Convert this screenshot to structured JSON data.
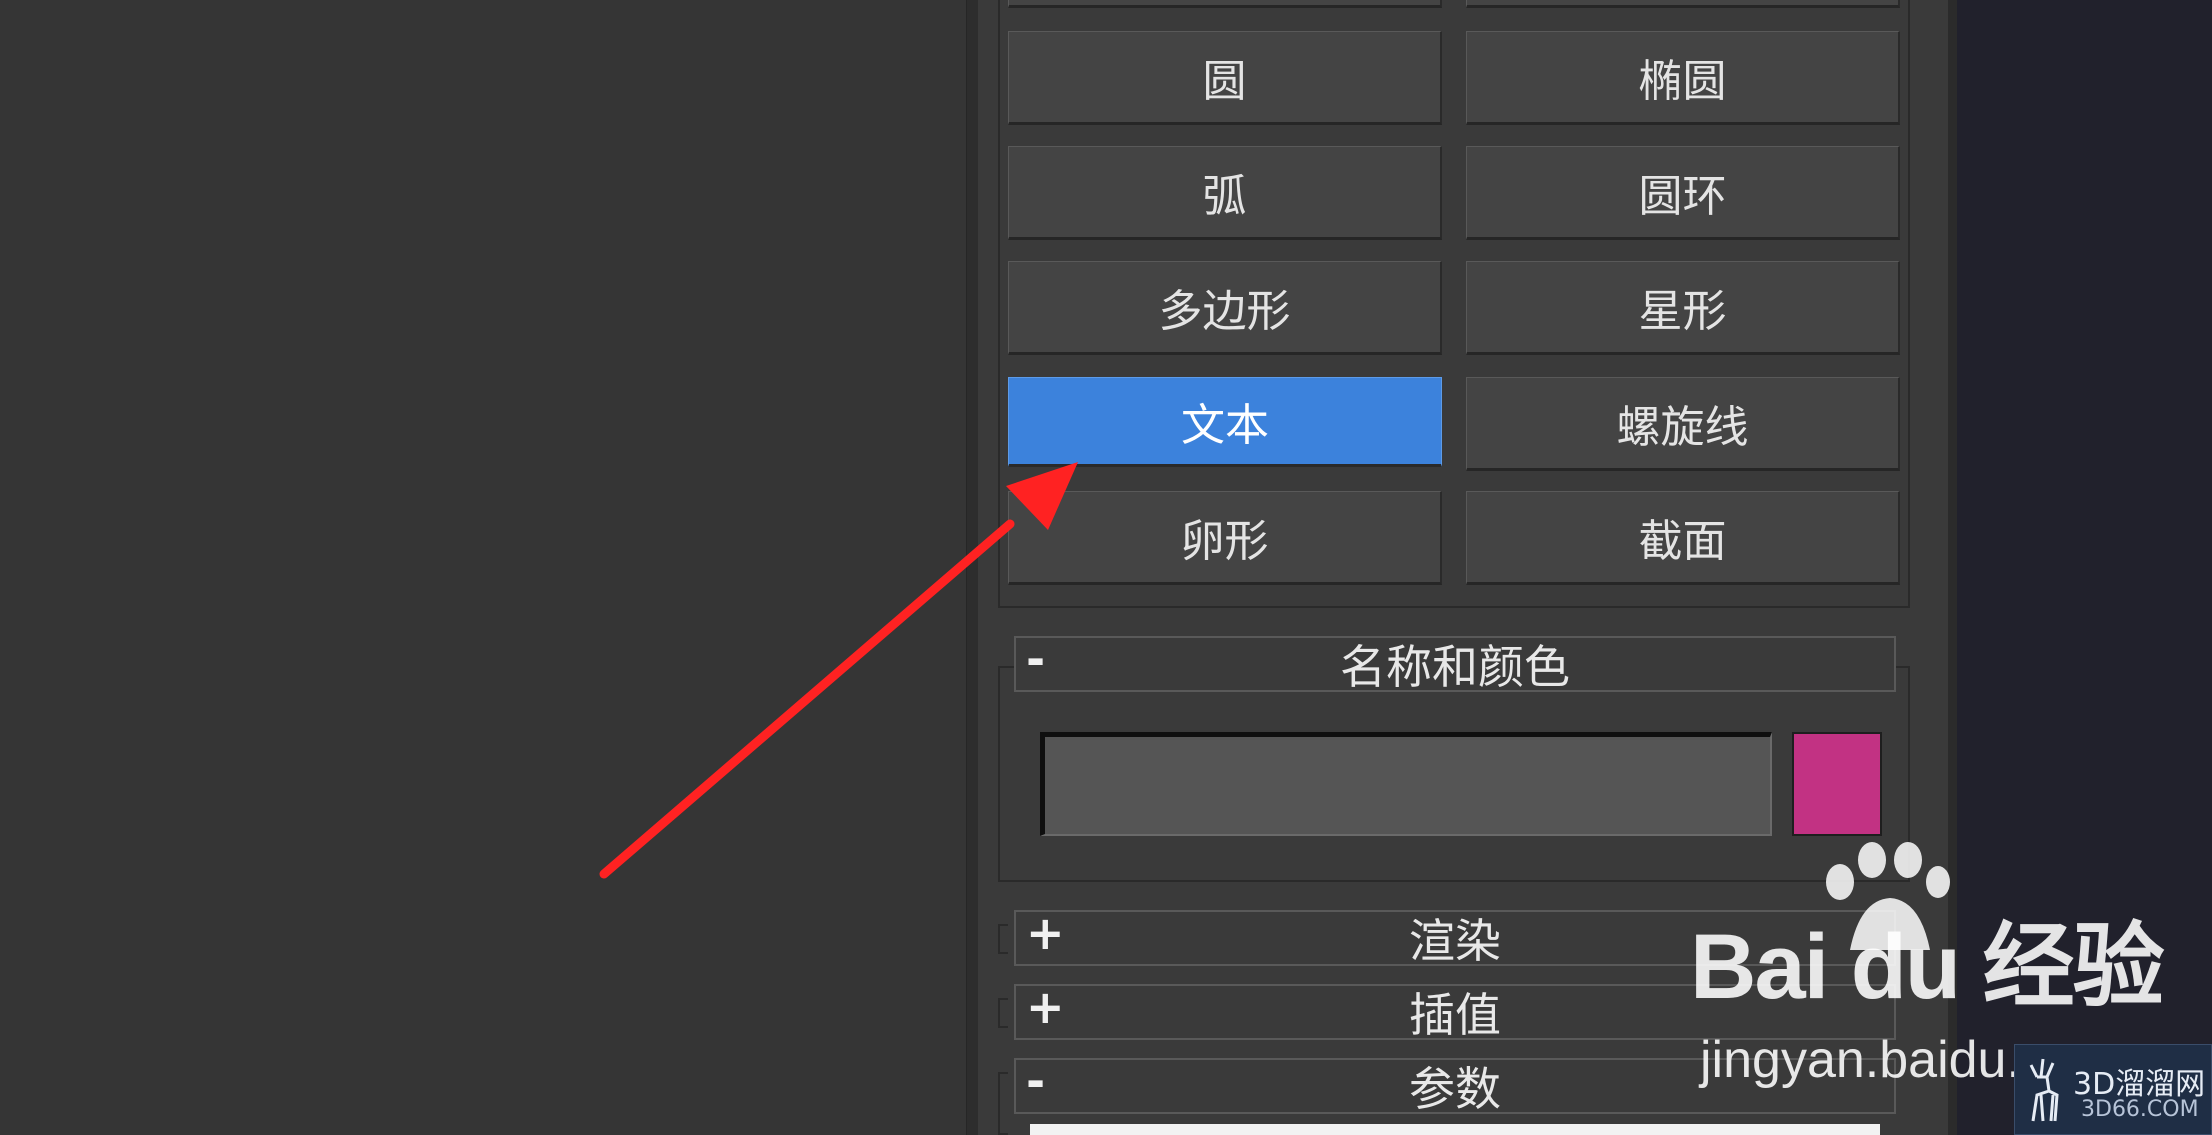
{
  "shape_buttons": {
    "circle": "圆",
    "ellipse": "椭圆",
    "arc": "弧",
    "donut": "圆环",
    "polygon": "多边形",
    "star": "星形",
    "text": "文本",
    "helix": "螺旋线",
    "egg": "卵形",
    "section": "截面"
  },
  "rollouts": {
    "name_color": {
      "sign": "-",
      "title": "名称和颜色"
    },
    "rendering": {
      "sign": "+",
      "title": "渲染"
    },
    "interpolation": {
      "sign": "+",
      "title": "插值"
    },
    "parameters": {
      "sign": "-",
      "title": "参数"
    }
  },
  "name_field": {
    "value": ""
  },
  "object_color": "#c23283",
  "active_button_color": "#3c82dc",
  "annotation": {
    "type": "red-arrow",
    "color": "#ff2222",
    "target": "text-button"
  },
  "watermark": {
    "logo": "Bai du 经验",
    "url": "jingyan.baidu.c",
    "badge_title": "3D溜溜网",
    "badge_sub": "3D66.COM"
  }
}
